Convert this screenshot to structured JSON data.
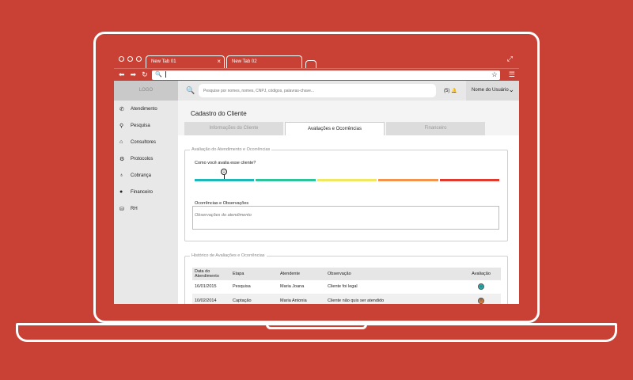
{
  "browser": {
    "tabs": [
      {
        "label": "New Tab 01",
        "active": true
      },
      {
        "label": "New Tab 02",
        "active": false
      }
    ],
    "close_glyph": "×"
  },
  "app": {
    "logo": "LOGO",
    "search_placeholder": "Pesquise por nomes, nomes, CNPJ, códigos, palavras-chave...",
    "notifications": "(5)",
    "user_name": "Nome do Usuário",
    "nav": [
      {
        "label": "Atendimento",
        "icon": "phone-icon"
      },
      {
        "label": "Pesquisa",
        "icon": "search-icon"
      },
      {
        "label": "Consultores",
        "icon": "home-icon"
      },
      {
        "label": "Protocolos",
        "icon": "gear-icon"
      },
      {
        "label": "Cobrança",
        "icon": "money-bag-icon"
      },
      {
        "label": "Financeiro",
        "icon": "dollar-icon"
      },
      {
        "label": "RH",
        "icon": "database-icon"
      }
    ]
  },
  "page": {
    "title": "Cadastro do Cliente",
    "tabs": [
      {
        "label": "Informações do Cliente",
        "active": false
      },
      {
        "label": "Avaliações e Ocorrências",
        "active": true
      },
      {
        "label": "Financeiro",
        "active": false
      }
    ],
    "evaluation": {
      "legend": "Avaliação do Atendimento e Ocorrências",
      "question": "Como você avalia  esse cliente?",
      "rating_colors": [
        "#1fb7b7",
        "#2fc39a",
        "#f1e861",
        "#f2934e",
        "#e03a2f"
      ],
      "selected_level": 0.1
    },
    "occurrences": {
      "label": "Ocorrências e Observações",
      "placeholder": "Observações do atendimento"
    },
    "history": {
      "legend": "Histórico de Avaliações e Ocorrências",
      "headers": [
        "Data do Atendimento",
        "Etapa",
        "Atendente",
        "Observação",
        "Avaliação"
      ],
      "rows": [
        {
          "data": "16/01/2015",
          "etapa": "Pesquisa",
          "atendente": "Maria Joana",
          "observacao": "Cliente foi legal",
          "avaliacao_color": "#1fb7b7",
          "face": "☺"
        },
        {
          "data": "10/02/2014",
          "etapa": "Captação",
          "atendente": "Maria Antonia",
          "observacao": "Cliente não quis ser atendido",
          "avaliacao_color": "#f2934e",
          "face": "☹"
        }
      ]
    }
  }
}
